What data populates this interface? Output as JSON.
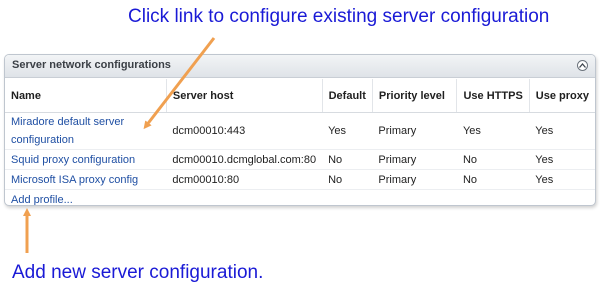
{
  "annotations": {
    "top": "Click link to configure existing server configuration",
    "bottom": "Add new server configuration."
  },
  "panel": {
    "title": "Server network configurations",
    "collapse_icon": "chevron-up-icon",
    "columns": [
      "Name",
      "Server host",
      "Default",
      "Priority level",
      "Use HTTPS",
      "Use proxy"
    ],
    "rows": [
      {
        "name": "Miradore default server configuration",
        "host": "dcm00010:443",
        "default": "Yes",
        "priority": "Primary",
        "https": "Yes",
        "proxy": "Yes"
      },
      {
        "name": "Squid proxy configuration",
        "host": "dcm00010.dcmglobal.com:80",
        "default": "No",
        "priority": "Primary",
        "https": "No",
        "proxy": "Yes"
      },
      {
        "name": "Microsoft ISA proxy config",
        "host": "dcm00010:80",
        "default": "No",
        "priority": "Primary",
        "https": "No",
        "proxy": "Yes"
      }
    ],
    "add_profile_label": "Add profile..."
  },
  "colors": {
    "annotation_text": "#1a1ad6",
    "arrow": "#f0a050",
    "link": "#1f4fa3"
  }
}
